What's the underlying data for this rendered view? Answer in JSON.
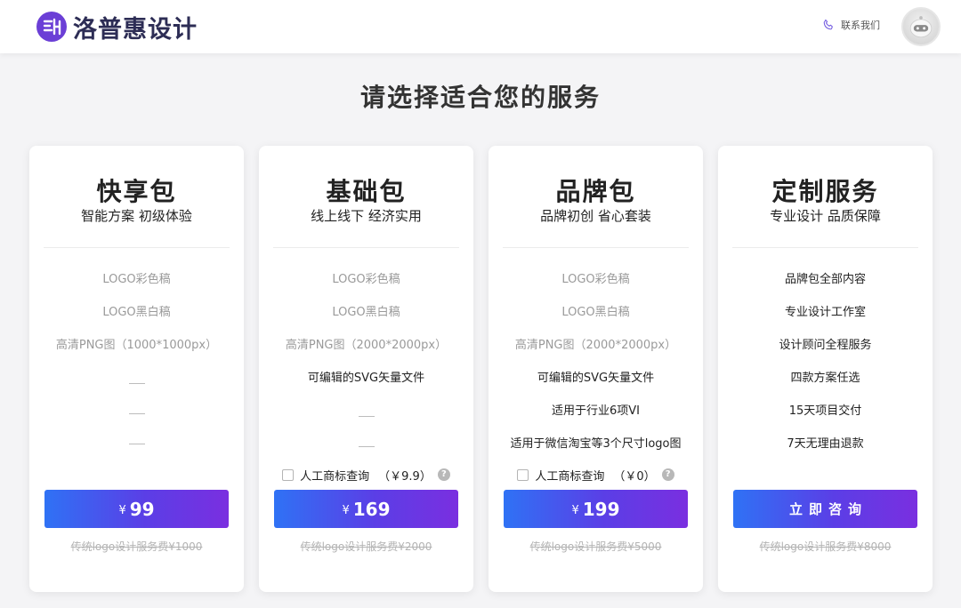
{
  "header": {
    "brand_name": "洛普惠设计",
    "contact_label": "联系我们"
  },
  "page_title": "请选择适合您的服务",
  "colors": {
    "button_gradient": [
      "#2f72f5",
      "#5b3ee6",
      "#7a2fe0"
    ],
    "brand_text": "#2d2d55",
    "logo_accent": "#6b3fd6"
  },
  "plans": [
    {
      "title": "快享包",
      "subtitle": "智能方案 初级体验",
      "features": [
        "LOGO彩色稿",
        "LOGO黑白稿",
        "高清PNG图（1000*1000px）"
      ],
      "currency": "¥",
      "price": "99",
      "reference_price": "传统logo设计服务费¥1000"
    },
    {
      "title": "基础包",
      "subtitle": "线上线下 经济实用",
      "features": [
        "LOGO彩色稿",
        "LOGO黑白稿",
        "高清PNG图（2000*2000px）",
        "可编辑的SVG矢量文件"
      ],
      "addon_label": "人工商标查询",
      "addon_price": "（￥9.9）",
      "currency": "¥",
      "price": "169",
      "reference_price": "传统logo设计服务费¥2000"
    },
    {
      "title": "品牌包",
      "subtitle": "品牌初创 省心套装",
      "features": [
        "LOGO彩色稿",
        "LOGO黑白稿",
        "高清PNG图（2000*2000px）",
        "可编辑的SVG矢量文件",
        "适用于行业6项VI",
        "适用于微信淘宝等3个尺寸logo图"
      ],
      "addon_label": "人工商标查询",
      "addon_price": "（￥0）",
      "currency": "¥",
      "price": "199",
      "reference_price": "传统logo设计服务费¥5000"
    },
    {
      "title": "定制服务",
      "subtitle": "专业设计 品质保障",
      "features": [
        "品牌包全部内容",
        "专业设计工作室",
        "设计顾问全程服务",
        "四款方案任选",
        "15天项目交付",
        "7天无理由退款"
      ],
      "button_label": "立即咨询",
      "reference_price": "传统logo设计服务费¥8000"
    }
  ]
}
